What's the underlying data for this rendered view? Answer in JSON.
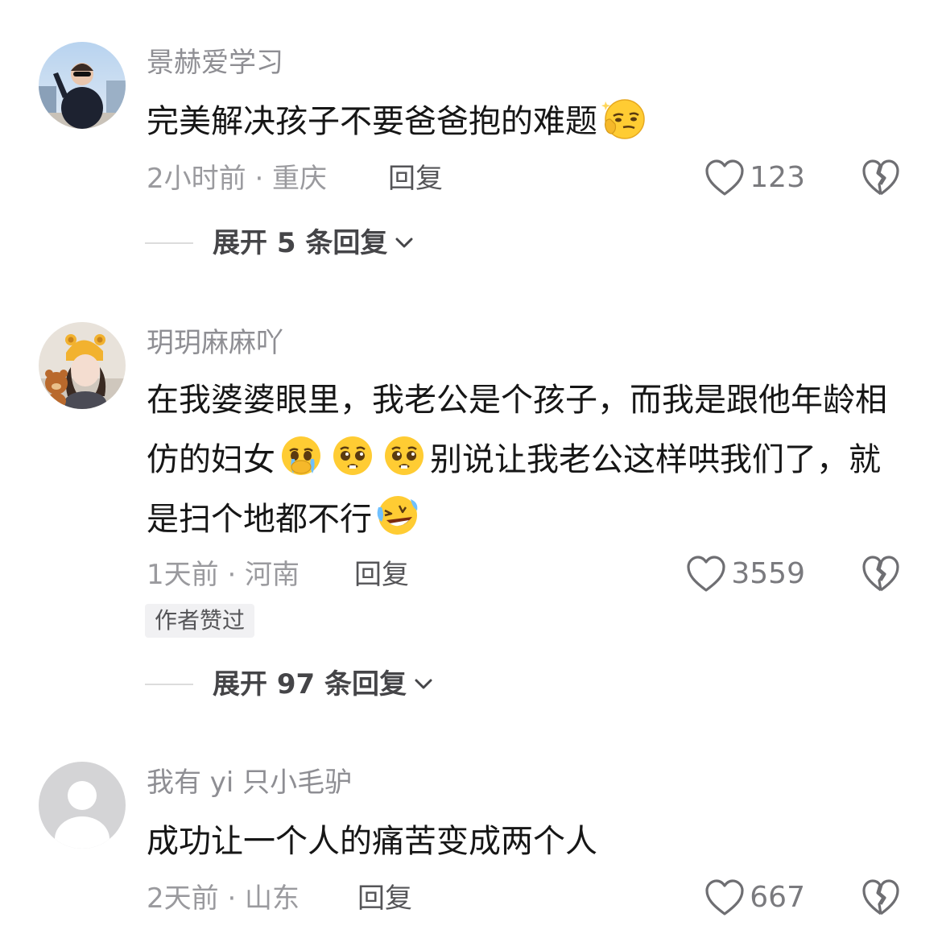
{
  "comments": [
    {
      "username": "景赫爱学习",
      "text_before": "完美解决孩子不要爸爸抱的难题",
      "text_after": "",
      "emoji_after": "thinking-smirk-emoji",
      "time_location": "2小时前 · 重庆",
      "reply_label": "回复",
      "likes": "123",
      "expand_label": "展开 5 条回复"
    },
    {
      "username": "玥玥麻麻吖",
      "text_part1": "在我婆婆眼里，我老公是个孩子，而我是跟他年龄相仿的妇女",
      "text_part2": "别说让我老公这样哄我们了，就是扫个地都不行",
      "emojis_middle": [
        "crying-face-emoji",
        "pleading-face-emoji",
        "pleading-face-emoji"
      ],
      "emoji_end": "laughing-crying-emoji",
      "time_location": "1天前 · 河南",
      "reply_label": "回复",
      "likes": "3559",
      "author_badge": "作者赞过",
      "expand_label": "展开 97 条回复"
    },
    {
      "username": "我有 yi 只小毛驴",
      "text": "成功让一个人的痛苦变成两个人",
      "time_location": "2天前 · 山东",
      "reply_label": "回复",
      "likes": "667"
    }
  ],
  "colors": {
    "username": "#8e8e93",
    "body_text": "#161616",
    "meta": "#9a9a9e",
    "emoji_yellow": "#ffcc33"
  }
}
